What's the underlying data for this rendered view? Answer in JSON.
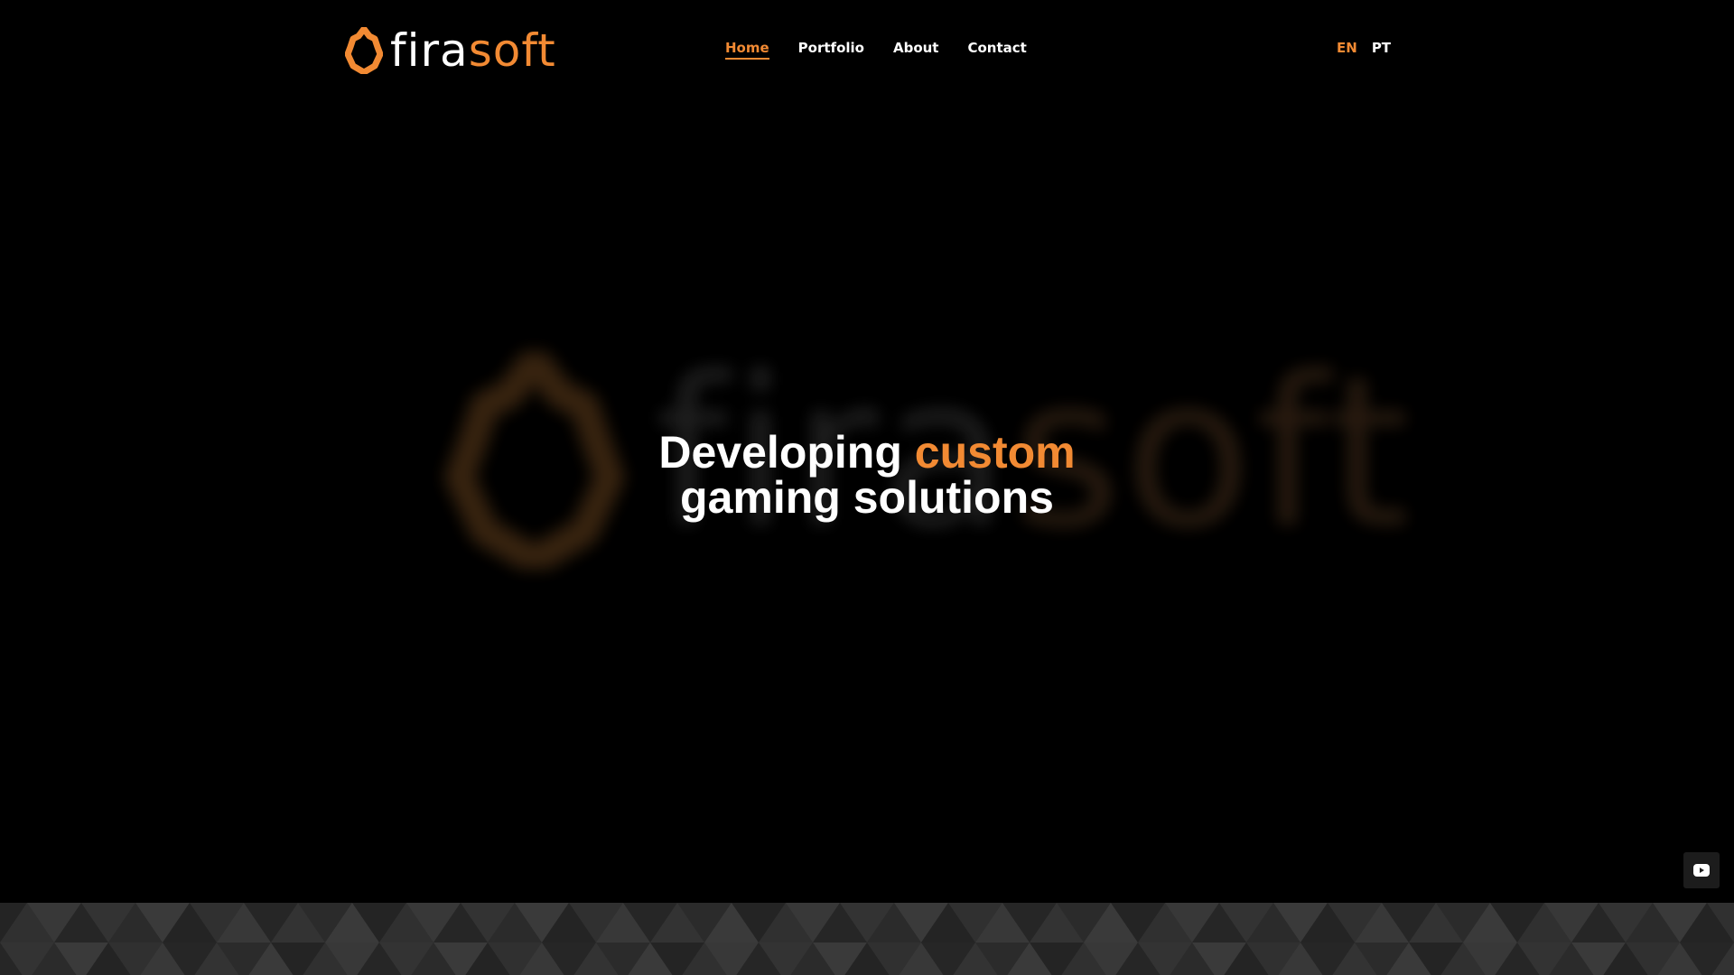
{
  "brand": {
    "word_part1": "fira",
    "word_part2": "soft",
    "accent_color": "#f28a33"
  },
  "nav": {
    "items": [
      {
        "label": "Home",
        "active": true
      },
      {
        "label": "Portfolio",
        "active": false
      },
      {
        "label": "About",
        "active": false
      },
      {
        "label": "Contact",
        "active": false
      }
    ]
  },
  "language": {
    "options": [
      "EN",
      "PT"
    ],
    "selected": "EN"
  },
  "hero": {
    "title_part1": "Developing",
    "title_accent": "custom",
    "title_line2": "gaming solutions",
    "background_word_part1": "fira",
    "background_word_part2": "soft"
  },
  "floating_button": {
    "icon": "youtube-icon"
  }
}
